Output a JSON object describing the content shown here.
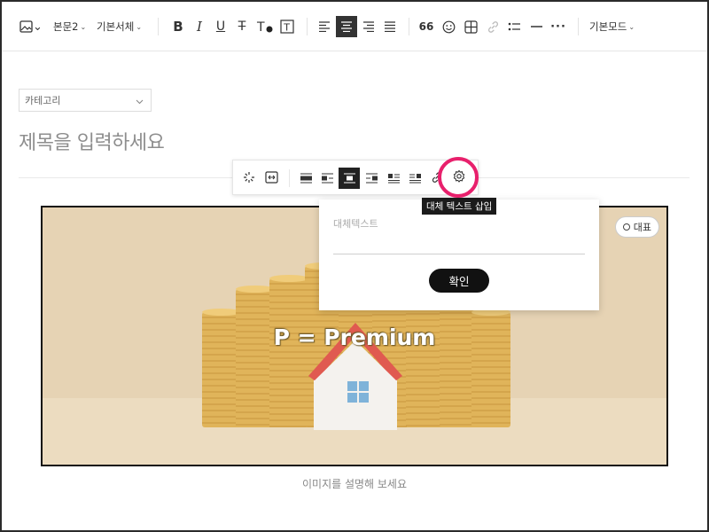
{
  "toolbar": {
    "paragraph_style": "본문2",
    "font_family": "기본서체",
    "mode": "기본모드",
    "quote_glyph": "66",
    "more_glyph": "···"
  },
  "editor": {
    "category_label": "카테고리",
    "title_placeholder": "제목을 입력하세요",
    "caption_placeholder": "이미지를 설명해 보세요"
  },
  "image": {
    "overlay_text": "P = Premium",
    "representative_label": "대표"
  },
  "image_toolbar": {
    "tooltip": "대체 텍스트 삽입"
  },
  "alt_popup": {
    "placeholder": "대체텍스트",
    "value": "",
    "confirm_label": "확인"
  },
  "colors": {
    "highlight": "#e8206c",
    "active_button": "#333333",
    "image_background": "#e6d3b4",
    "coin": "#e0b45a",
    "roof": "#e05a50"
  }
}
